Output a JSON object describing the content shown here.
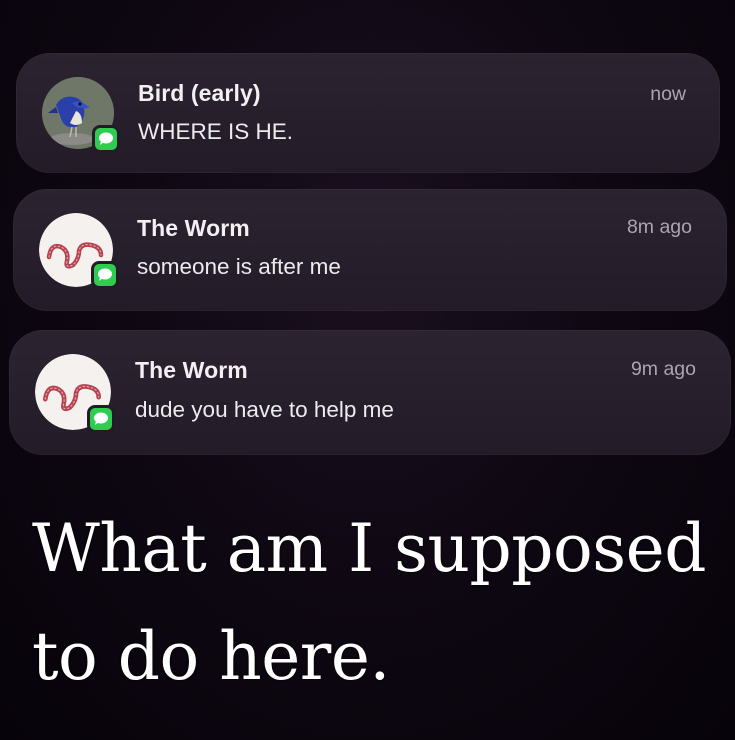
{
  "notifications": [
    {
      "sender": "Bird (early)",
      "message": "WHERE IS HE.",
      "time": "now",
      "avatar_icon": "bluebird-avatar-icon",
      "app_icon": "messages-app-icon"
    },
    {
      "sender": "The Worm",
      "message": "someone is after me",
      "time": "8m ago",
      "avatar_icon": "worm-avatar-icon",
      "app_icon": "messages-app-icon"
    },
    {
      "sender": "The Worm",
      "message": "dude you have to help me",
      "time": "9m ago",
      "avatar_icon": "worm-avatar-icon",
      "app_icon": "messages-app-icon"
    }
  ],
  "caption": "What am I supposed to do here.",
  "colors": {
    "background": "#0c0610",
    "card": "#2b2330",
    "badge_green": "#2ecc4f",
    "time_text": "#aba5b0"
  }
}
